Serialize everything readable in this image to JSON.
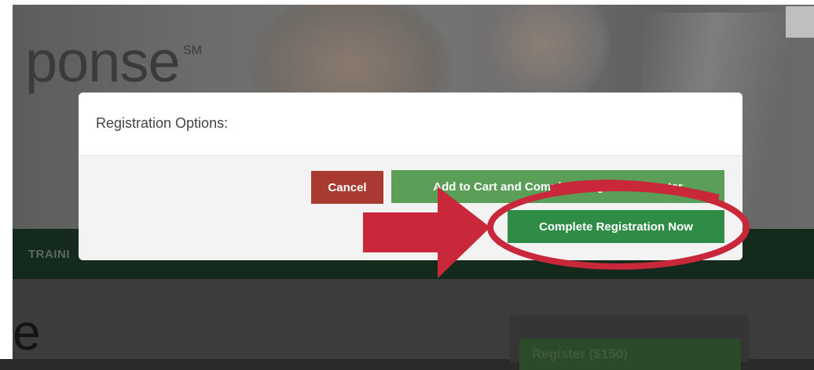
{
  "background": {
    "logo_text": "ponse",
    "logo_superscript": "SM",
    "nav_item": "TRAINI",
    "page_heading": "e",
    "register_button": "Register ($150)"
  },
  "modal": {
    "title": "Registration Options:",
    "cancel_label": "Cancel",
    "add_to_cart_label": "Add to Cart and Complete Registration Later",
    "complete_now_label": "Complete Registration Now"
  },
  "annotation": {
    "arrow_color": "#c8283a",
    "ellipse_color": "#c8283a"
  },
  "colors": {
    "cancel": "#a83a32",
    "add_to_cart": "#5b9e58",
    "complete_now": "#2e8c47",
    "nav_bar": "#142a1c"
  }
}
